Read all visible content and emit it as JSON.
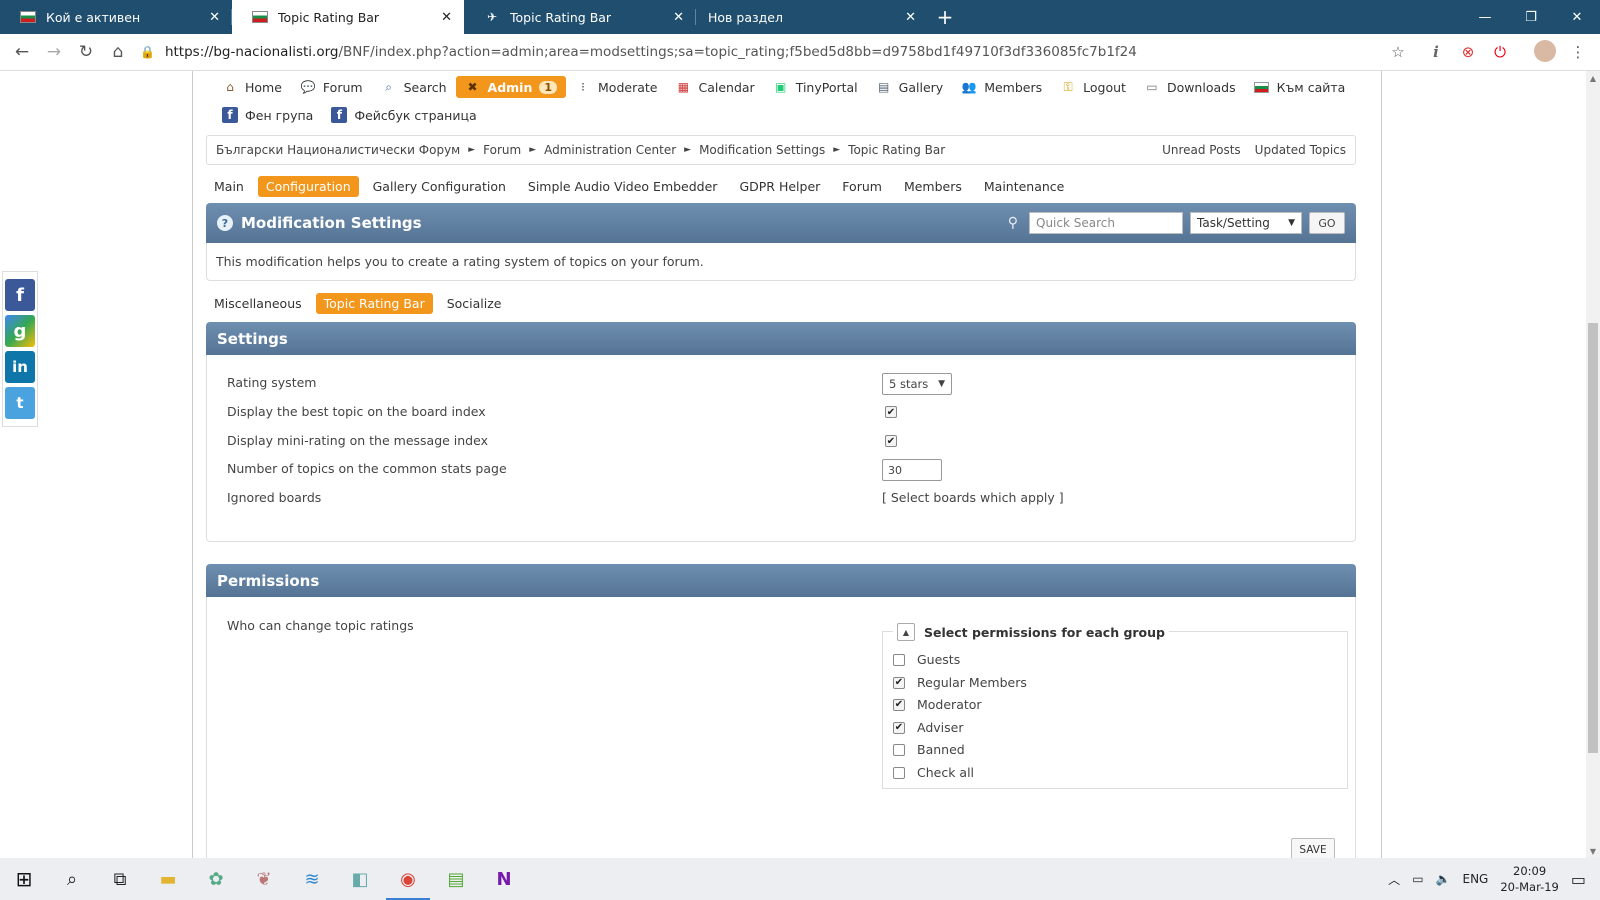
{
  "browser": {
    "tabs": [
      {
        "title": "Кой е активен",
        "fav": "bg-flag-icon",
        "active": false
      },
      {
        "title": "Topic Rating Bar",
        "fav": "bg-flag-icon",
        "active": true
      },
      {
        "title": "Topic Rating Bar",
        "fav": "plane-icon",
        "active": false
      },
      {
        "title": "Нов раздел",
        "fav": "none",
        "active": false
      }
    ],
    "url_host": "https://bg-nacionalisti.org",
    "url_path": "/BNF/index.php?action=admin;area=modsettings;sa=topic_rating;f5bed5d8bb=d9758bd1f49710f3df336085fc7b1f24"
  },
  "main_menu": {
    "items": [
      {
        "label": "Home",
        "icon": "home-icon"
      },
      {
        "label": "Forum",
        "icon": "forum-icon"
      },
      {
        "label": "Search",
        "icon": "search-icon"
      },
      {
        "label": "Admin",
        "icon": "tools-icon",
        "badge": "1",
        "active": true
      },
      {
        "label": "Moderate",
        "icon": "traffic-light-icon"
      },
      {
        "label": "Calendar",
        "icon": "calendar-icon"
      },
      {
        "label": "TinyPortal",
        "icon": "blocks-icon"
      },
      {
        "label": "Gallery",
        "icon": "gallery-icon"
      },
      {
        "label": "Members",
        "icon": "members-icon"
      },
      {
        "label": "Logout",
        "icon": "key-icon"
      },
      {
        "label": "Downloads",
        "icon": "downloads-icon"
      },
      {
        "label": "Към сайта",
        "icon": "bg-flag-icon"
      },
      {
        "label": "Фен група",
        "icon": "facebook-icon"
      },
      {
        "label": "Фейсбук страница",
        "icon": "facebook-icon"
      }
    ]
  },
  "breadcrumb": {
    "items": [
      "Български Националистически Форум",
      "Forum",
      "Administration Center",
      "Modification Settings",
      "Topic Rating Bar"
    ],
    "links_right": [
      "Unread Posts",
      "Updated Topics"
    ]
  },
  "admin_tabs": [
    "Main",
    "Configuration",
    "Gallery Configuration",
    "Simple Audio Video Embedder",
    "GDPR Helper",
    "Forum",
    "Members",
    "Maintenance"
  ],
  "mod_header": {
    "title": "Modification Settings",
    "quick_search_placeholder": "Quick Search",
    "search_type": "Task/Setting",
    "go_label": "GO",
    "description": "This modification helps you to create a rating system of topics on your forum."
  },
  "sub_tabs": [
    "Miscellaneous",
    "Topic Rating Bar",
    "Socialize"
  ],
  "settings": {
    "title": "Settings",
    "rating_system_label": "Rating system",
    "rating_system_value": "5 stars",
    "best_topic_label": "Display the best topic on the board index",
    "best_topic_checked": true,
    "mini_rating_label": "Display mini-rating on the message index",
    "mini_rating_checked": true,
    "num_topics_label": "Number of topics on the common stats page",
    "num_topics_value": "30",
    "ignored_boards_label": "Ignored boards",
    "ignored_boards_link": "[ Select boards which apply ]"
  },
  "permissions": {
    "title": "Permissions",
    "who_label": "Who can change topic ratings",
    "group_legend": "Select permissions for each group",
    "groups": [
      {
        "label": "Guests",
        "checked": false
      },
      {
        "label": "Regular Members",
        "checked": true
      },
      {
        "label": "Moderator",
        "checked": true
      },
      {
        "label": "Adviser",
        "checked": true
      },
      {
        "label": "Banned",
        "checked": false
      },
      {
        "label": "Check all",
        "checked": false
      }
    ],
    "save_label": "SAVE"
  },
  "taskbar": {
    "lang": "ENG",
    "time": "20:09",
    "date": "20-Mar-19"
  },
  "colors": {
    "accent": "#f3961c",
    "catbar": "#5f7ea0",
    "tabstrip": "#1f4e6e"
  }
}
